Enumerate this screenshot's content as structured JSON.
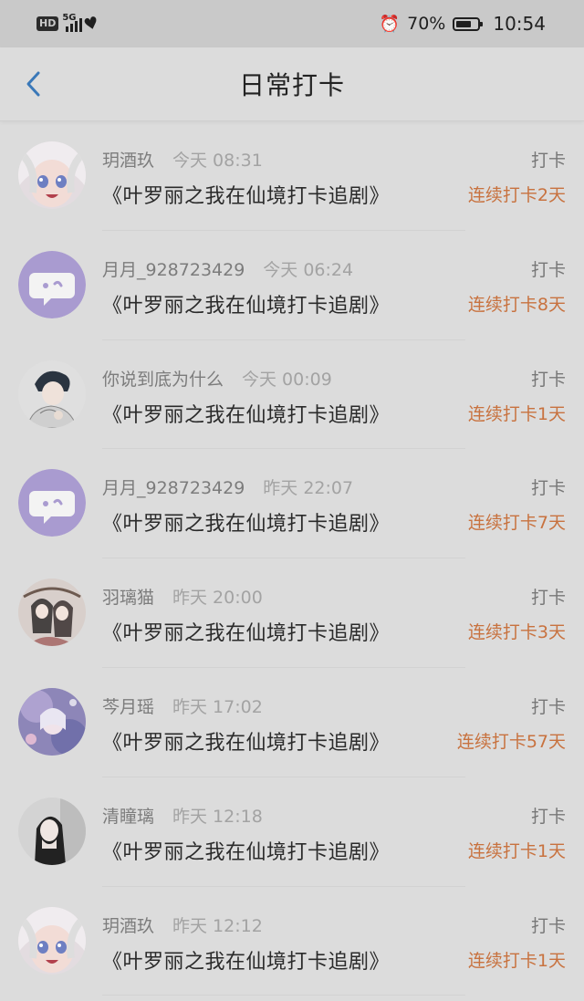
{
  "statusbar": {
    "hd": "HD",
    "network": "5G",
    "battery_percent": "70%",
    "battery_level": 0.7,
    "time": "10:54"
  },
  "header": {
    "title": "日常打卡",
    "back_icon": "chevron-left-icon"
  },
  "colors": {
    "accent_blue": "#3a78b8",
    "streak_orange": "#c8723f"
  },
  "checkins": [
    {
      "name": "玥酒玖",
      "time": "今天 08:31",
      "action": "打卡",
      "book": "《叶罗丽之我在仙境打卡追剧》",
      "streak": "连续打卡2天",
      "avatar": "anime-girl-white-hair"
    },
    {
      "name": "月月_928723429",
      "time": "今天 06:24",
      "action": "打卡",
      "book": "《叶罗丽之我在仙境打卡追剧》",
      "streak": "连续打卡8天",
      "avatar": "purple-chat-bubble"
    },
    {
      "name": "你说到底为什么",
      "time": "今天 00:09",
      "action": "打卡",
      "book": "《叶罗丽之我在仙境打卡追剧》",
      "streak": "连续打卡1天",
      "avatar": "anime-boy-sketch"
    },
    {
      "name": "月月_928723429",
      "time": "昨天 22:07",
      "action": "打卡",
      "book": "《叶罗丽之我在仙境打卡追剧》",
      "streak": "连续打卡7天",
      "avatar": "purple-chat-bubble"
    },
    {
      "name": "羽璃猫",
      "time": "昨天 20:00",
      "action": "打卡",
      "book": "《叶罗丽之我在仙境打卡追剧》",
      "streak": "连续打卡3天",
      "avatar": "two-girls-painting"
    },
    {
      "name": "芩月瑶",
      "time": "昨天 17:02",
      "action": "打卡",
      "book": "《叶罗丽之我在仙境打卡追剧》",
      "streak": "连续打卡57天",
      "avatar": "dreamy-anime-art"
    },
    {
      "name": "清瞳璃",
      "time": "昨天 12:18",
      "action": "打卡",
      "book": "《叶罗丽之我在仙境打卡追剧》",
      "streak": "连续打卡1天",
      "avatar": "girl-photo"
    },
    {
      "name": "玥酒玖",
      "time": "昨天 12:12",
      "action": "打卡",
      "book": "《叶罗丽之我在仙境打卡追剧》",
      "streak": "连续打卡1天",
      "avatar": "anime-girl-white-hair"
    }
  ]
}
